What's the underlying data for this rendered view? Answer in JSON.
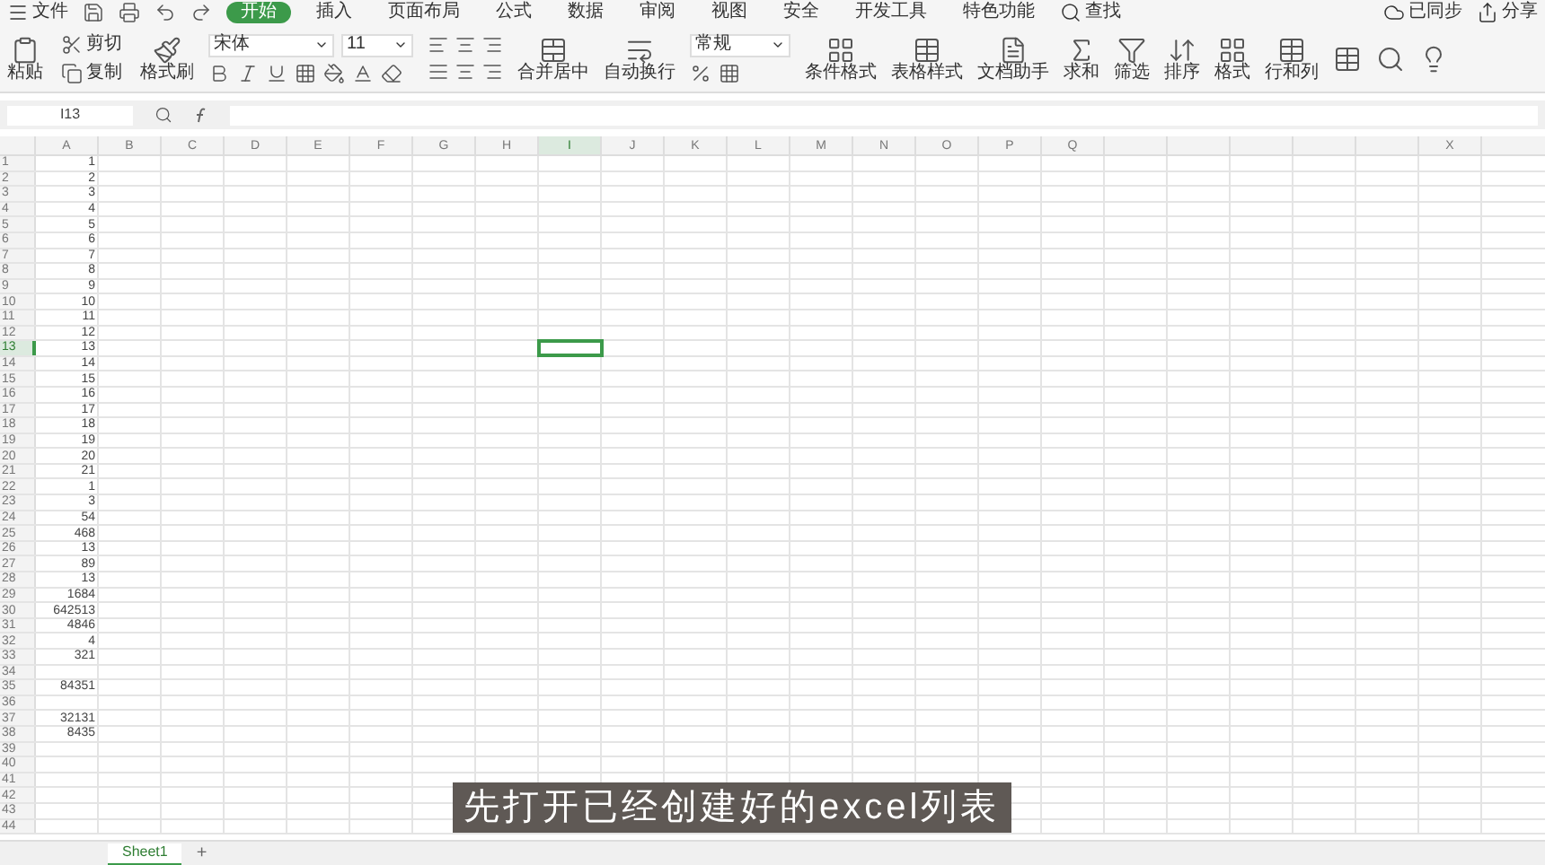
{
  "menu": {
    "file": "文件",
    "tabs": [
      {
        "label": "开始",
        "selected": true
      },
      {
        "label": "插入",
        "selected": false
      },
      {
        "label": "页面布局",
        "selected": false
      },
      {
        "label": "公式",
        "selected": false
      },
      {
        "label": "数据",
        "selected": false
      },
      {
        "label": "审阅",
        "selected": false
      },
      {
        "label": "视图",
        "selected": false
      },
      {
        "label": "安全",
        "selected": false
      },
      {
        "label": "开发工具",
        "selected": false
      },
      {
        "label": "特色功能",
        "selected": false
      }
    ],
    "search": "查找",
    "sync": "已同步",
    "share": "分享"
  },
  "ribbon": {
    "paste": "粘贴",
    "cut": "剪切",
    "copy": "复制",
    "format_painter": "格式刷",
    "font": "宋体",
    "font_size": "11",
    "merge": "合并居中",
    "wrap": "自动换行",
    "number_format": "常规",
    "tools": [
      {
        "label": "条件格式",
        "kind": "grid"
      },
      {
        "label": "表格样式",
        "kind": "table"
      },
      {
        "label": "文档助手",
        "kind": "doc"
      },
      {
        "label": "求和",
        "kind": "sum"
      },
      {
        "label": "筛选",
        "kind": "filter"
      },
      {
        "label": "排序",
        "kind": "sort"
      },
      {
        "label": "格式",
        "kind": "grid"
      },
      {
        "label": "行和列",
        "kind": "table"
      }
    ]
  },
  "formula_bar": {
    "name_box": "I13"
  },
  "grid": {
    "columns": [
      {
        "label": "A",
        "selected": false
      },
      {
        "label": "B",
        "selected": false
      },
      {
        "label": "C",
        "selected": false
      },
      {
        "label": "D",
        "selected": false
      },
      {
        "label": "E",
        "selected": false
      },
      {
        "label": "F",
        "selected": false
      },
      {
        "label": "G",
        "selected": false
      },
      {
        "label": "H",
        "selected": false
      },
      {
        "label": "I",
        "selected": true
      },
      {
        "label": "J",
        "selected": false
      },
      {
        "label": "K",
        "selected": false
      },
      {
        "label": "L",
        "selected": false
      },
      {
        "label": "M",
        "selected": false
      },
      {
        "label": "N",
        "selected": false
      },
      {
        "label": "O",
        "selected": false
      },
      {
        "label": "P",
        "selected": false
      },
      {
        "label": "Q",
        "selected": false
      },
      {
        "label": "X",
        "selected": false
      }
    ],
    "rows": [
      {
        "header": "1",
        "a": "1",
        "selected": false
      },
      {
        "header": "2",
        "a": "2",
        "selected": false
      },
      {
        "header": "3",
        "a": "3",
        "selected": false
      },
      {
        "header": "4",
        "a": "4",
        "selected": false
      },
      {
        "header": "5",
        "a": "5",
        "selected": false
      },
      {
        "header": "6",
        "a": "6",
        "selected": false
      },
      {
        "header": "7",
        "a": "7",
        "selected": false
      },
      {
        "header": "8",
        "a": "8",
        "selected": false
      },
      {
        "header": "9",
        "a": "9",
        "selected": false
      },
      {
        "header": "10",
        "a": "10",
        "selected": false
      },
      {
        "header": "11",
        "a": "11",
        "selected": false
      },
      {
        "header": "12",
        "a": "12",
        "selected": false
      },
      {
        "header": "13",
        "a": "13",
        "selected": true
      },
      {
        "header": "14",
        "a": "14",
        "selected": false
      },
      {
        "header": "15",
        "a": "15",
        "selected": false
      },
      {
        "header": "16",
        "a": "16",
        "selected": false
      },
      {
        "header": "17",
        "a": "17",
        "selected": false
      },
      {
        "header": "18",
        "a": "18",
        "selected": false
      },
      {
        "header": "19",
        "a": "19",
        "selected": false
      },
      {
        "header": "20",
        "a": "20",
        "selected": false
      },
      {
        "header": "21",
        "a": "21",
        "selected": false
      },
      {
        "header": "22",
        "a": "1",
        "selected": false
      },
      {
        "header": "23",
        "a": "3",
        "selected": false
      },
      {
        "header": "24",
        "a": "54",
        "selected": false
      },
      {
        "header": "25",
        "a": "468",
        "selected": false
      },
      {
        "header": "26",
        "a": "13",
        "selected": false
      },
      {
        "header": "27",
        "a": "89",
        "selected": false
      },
      {
        "header": "28",
        "a": "13",
        "selected": false
      },
      {
        "header": "29",
        "a": "1684",
        "selected": false
      },
      {
        "header": "30",
        "a": "642513",
        "selected": false
      },
      {
        "header": "31",
        "a": "4846",
        "selected": false
      },
      {
        "header": "32",
        "a": "4",
        "selected": false
      },
      {
        "header": "33",
        "a": "321",
        "selected": false
      },
      {
        "header": "34",
        "selected": false
      },
      {
        "header": "35",
        "a": "84351",
        "selected": false
      },
      {
        "header": "36",
        "selected": false
      },
      {
        "header": "37",
        "a": "32131",
        "selected": false
      },
      {
        "header": "38",
        "a": "8435",
        "selected": false
      },
      {
        "header": "39",
        "selected": false
      },
      {
        "header": "40",
        "selected": false
      },
      {
        "header": "41",
        "selected": false
      },
      {
        "header": "42",
        "selected": false
      },
      {
        "header": "43",
        "selected": false
      },
      {
        "header": "44",
        "selected": false
      }
    ]
  },
  "sheets": [
    {
      "label": "Sheet1",
      "selected": true
    }
  ],
  "add_sheet": "+",
  "caption": "先打开已经创建好的excel列表"
}
